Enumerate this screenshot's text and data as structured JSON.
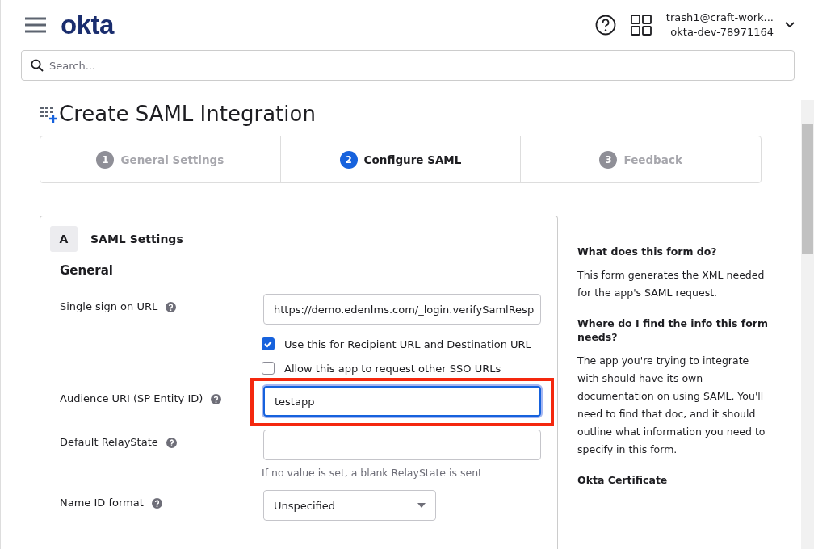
{
  "header": {
    "logo": "okta",
    "user_email": "trash1@craft-work...",
    "org": "okta-dev-78971164"
  },
  "search": {
    "placeholder": "Search..."
  },
  "page_title": "Create SAML Integration",
  "steps": [
    {
      "number": "1",
      "label": "General Settings",
      "selected": false
    },
    {
      "number": "2",
      "label": "Configure SAML",
      "selected": true
    },
    {
      "number": "3",
      "label": "Feedback",
      "selected": false
    }
  ],
  "section": {
    "letter": "A",
    "title": "SAML Settings",
    "subtitle": "General"
  },
  "fields": [
    {
      "kind": "text",
      "label": "Single sign on URL",
      "value": "https://demo.edenlms.com/_login.verifySamlResp",
      "focused": false,
      "highlighted": false,
      "options": [
        {
          "label": "Use this for Recipient URL and Destination URL",
          "checked": true
        },
        {
          "label": "Allow this app to request other SSO URLs",
          "checked": false
        }
      ]
    },
    {
      "kind": "text",
      "label": "Audience URI (SP Entity ID)",
      "value": "testapp",
      "focused": true,
      "highlighted": true
    },
    {
      "kind": "text",
      "label": "Default RelayState",
      "hint": "If no value is set, a blank RelayState is sent",
      "focused": false,
      "highlighted": false
    },
    {
      "kind": "select",
      "label": "Name ID format",
      "value": "Unspecified",
      "highlighted": false
    }
  ],
  "help": [
    {
      "heading": "What does this form do?",
      "body": "This form generates the XML needed for the app's SAML request."
    },
    {
      "heading": "Where do I find the info this form needs?",
      "body": "The app you're trying to integrate with should have its own documentation on using SAML. You'll need to find that doc, and it should outline what information you need to specify in this form."
    },
    {
      "heading": "Okta Certificate"
    }
  ]
}
